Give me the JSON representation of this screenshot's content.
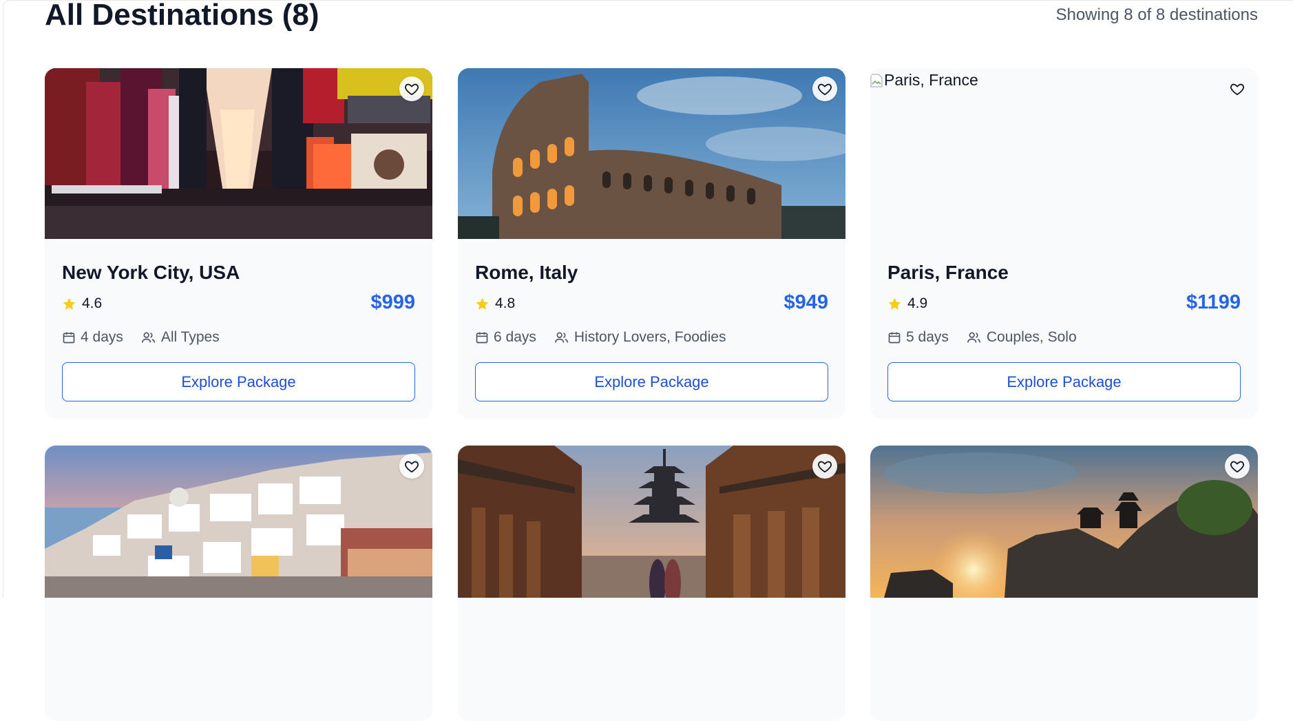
{
  "header": {
    "title": "All Destinations (8)",
    "showing": "Showing 8 of 8 destinations"
  },
  "explore_label": "Explore Package",
  "accent_color": "#2563eb",
  "star_color": "#facc15",
  "destinations": [
    {
      "name": "New York City, USA",
      "rating": "4.6",
      "price": "$999",
      "duration": "4 days",
      "audience": "All Types",
      "image": "times-square-photo"
    },
    {
      "name": "Rome, Italy",
      "rating": "4.8",
      "price": "$949",
      "duration": "6 days",
      "audience": "History Lovers, Foodies",
      "image": "colosseum-photo"
    },
    {
      "name": "Paris, France",
      "rating": "4.9",
      "price": "$1199",
      "duration": "5 days",
      "audience": "Couples, Solo",
      "image_alt": "Paris, France",
      "image": "broken-image"
    },
    {
      "image": "santorini-photo"
    },
    {
      "image": "kyoto-pagoda-photo"
    },
    {
      "image": "bali-temple-sunset-photo"
    }
  ]
}
